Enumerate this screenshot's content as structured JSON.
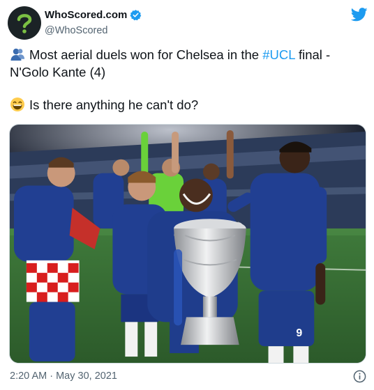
{
  "author": {
    "display_name": "WhoScored.com",
    "handle": "@WhoScored",
    "verified": true,
    "avatar_icon": "question-mark-logo-icon"
  },
  "tweet": {
    "line1_prefix": "Most aerial duels won for Chelsea in the ",
    "hashtag": "#UCL",
    "line1_suffix": " final -",
    "line2": "N'Golo Kante (4)",
    "line3": "Is there anything he can't do?",
    "emoji1": "person-silhouette-emoji",
    "emoji2": "grinning-face-emoji"
  },
  "media": {
    "photo_icon": "trophy-celebration-photo"
  },
  "meta": {
    "timestamp": "2:20 AM · May 30, 2021",
    "info_icon": "info-icon"
  },
  "colors": {
    "accent": "#1d9bf0",
    "text": "#0f1419",
    "secondary": "#536471",
    "chelsea_blue": "#1f3d8c"
  }
}
